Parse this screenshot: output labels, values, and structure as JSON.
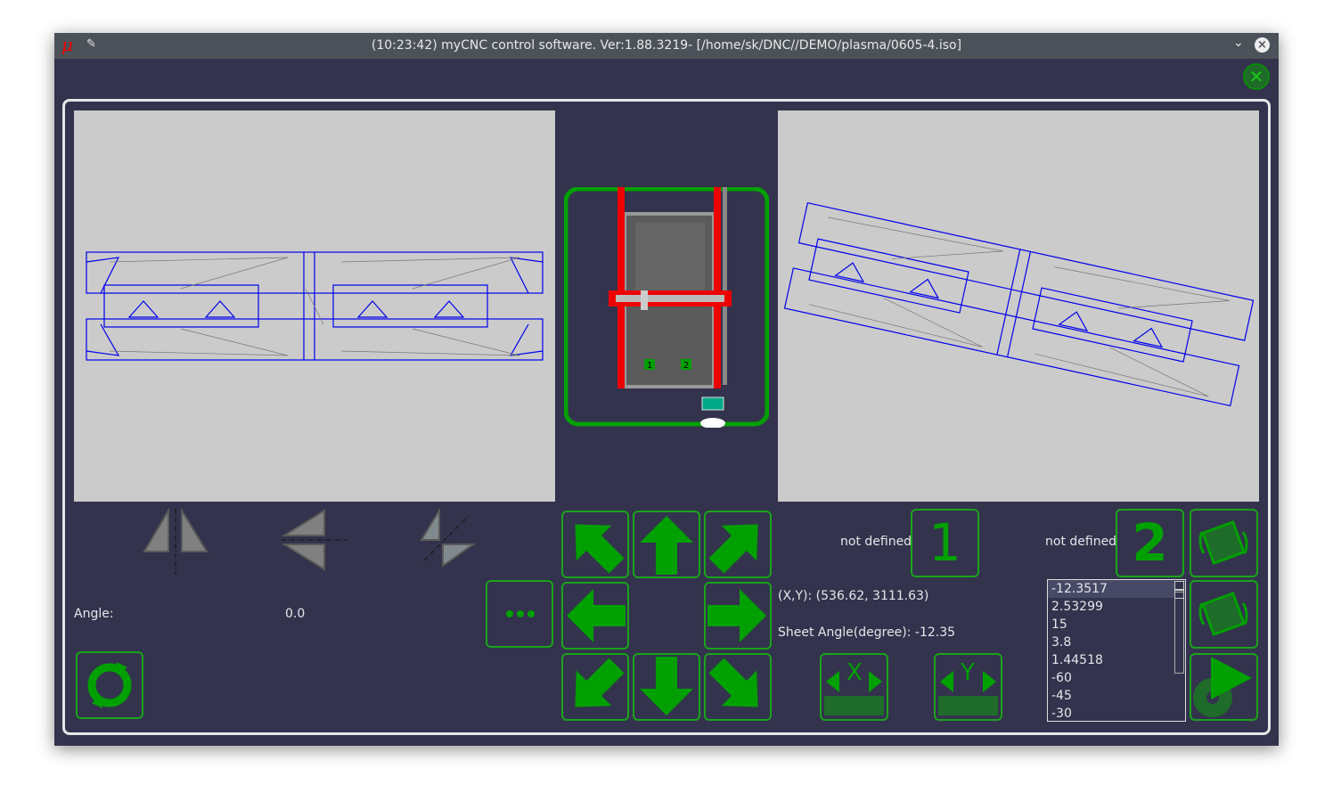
{
  "window": {
    "title": "(10:23:42) myCNC control software. Ver:1.88.3219- [/home/sk/DNC//DEMO/plasma/0605-4.iso]",
    "icons": [
      "mycnc-logo-icon",
      "pin-icon",
      "chevron-down-icon",
      "close-icon"
    ]
  },
  "machine": {
    "marker1": "1",
    "marker2": "2"
  },
  "left_panel": {
    "angle_label": "Angle:",
    "angle_value": "0.0"
  },
  "points": {
    "point1_status": "not defined",
    "point1_label": "1",
    "point2_status": "not defined",
    "point2_label": "2"
  },
  "info": {
    "xy": "(X,Y): (536.62, 3111.63)",
    "sheet_angle": "Sheet Angle(degree):  -12.35"
  },
  "measure": {
    "x_label": "X",
    "y_label": "Y"
  },
  "angle_list": [
    "-12.3517",
    "2.53299",
    "15",
    "3.8",
    "1.44518",
    "-60",
    "-45",
    "-30"
  ],
  "colors": {
    "accent": "#00a000",
    "background": "#33334d",
    "canvas": "#cbcbcb",
    "part_lines": "#0000ff"
  }
}
